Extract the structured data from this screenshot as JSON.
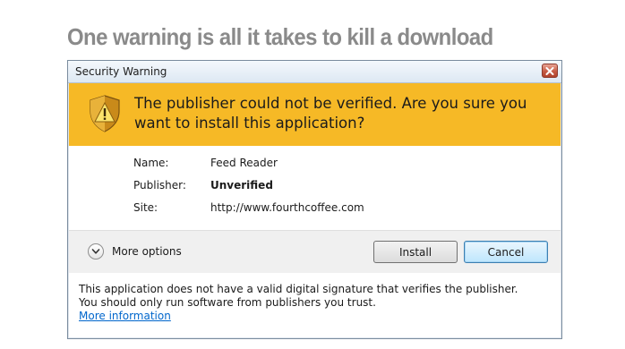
{
  "headline": "One warning is all it takes to kill a download",
  "dialog": {
    "title": "Security Warning",
    "close_icon": "close-icon",
    "banner": {
      "icon": "shield-warning-icon",
      "message": "The publisher could not be verified. Are you sure you want to install this application?",
      "color": "#f6b926"
    },
    "details": [
      {
        "label": "Name:",
        "value": "Feed Reader",
        "bold": false
      },
      {
        "label": "Publisher:",
        "value": "Unverified",
        "bold": true
      },
      {
        "label": "Site:",
        "value": "http://www.fourthcoffee.com",
        "bold": false
      }
    ],
    "more_options": {
      "icon": "chevron-down-icon",
      "label": "More options"
    },
    "buttons": {
      "install": "Install",
      "cancel": "Cancel"
    },
    "footer": {
      "line1": "This application does not have a valid digital signature that verifies the publisher.",
      "line2": "You should only run software from publishers you trust.",
      "link": "More information",
      "link_color": "#0066cc"
    }
  }
}
